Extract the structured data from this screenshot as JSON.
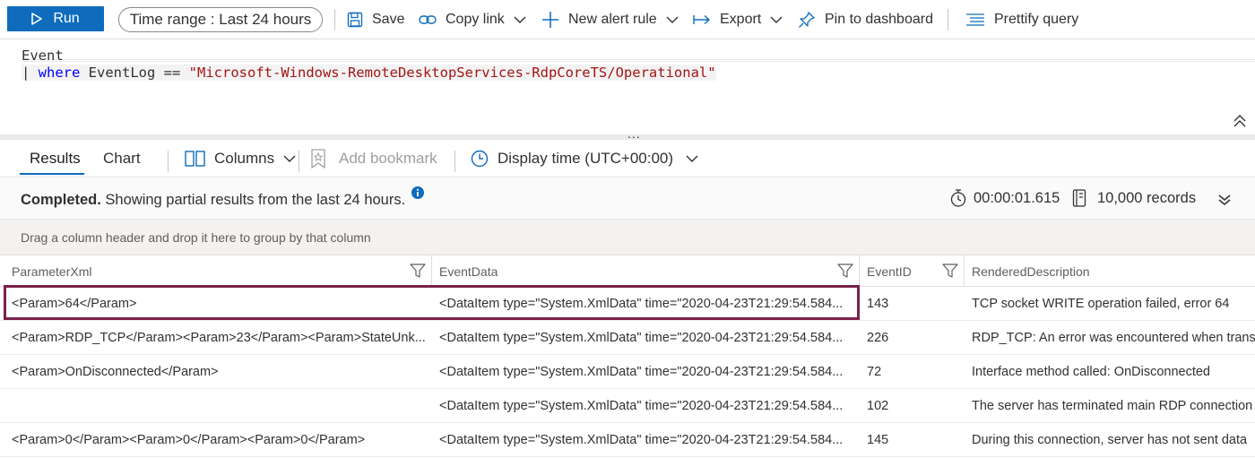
{
  "toolbar": {
    "run_label": "Run",
    "time_range_label": "Time range",
    "time_range_separator": " : ",
    "time_range_value": "Last 24 hours",
    "save_label": "Save",
    "copy_link_label": "Copy link",
    "new_alert_label": "New alert rule",
    "export_label": "Export",
    "pin_label": "Pin to dashboard",
    "prettify_label": "Prettify query",
    "accent_color": "#0f6cbd"
  },
  "editor": {
    "line1": "Event",
    "line2_pipe": "| ",
    "line2_keyword": "where",
    "line2_field": " EventLog == ",
    "line2_string": "\"Microsoft-Windows-RemoteDesktopServices-RdpCoreTS/Operational\"",
    "drag_handle": "..."
  },
  "results_tabs": {
    "results_label": "Results",
    "chart_label": "Chart",
    "columns_label": "Columns",
    "bookmark_label": "Add bookmark",
    "display_time_label": "Display time (UTC+00:00)"
  },
  "status": {
    "completed_label": "Completed.",
    "message": " Showing partial results from the last 24 hours.",
    "elapsed": "00:00:01.615",
    "records": "10,000 records"
  },
  "groupbar": {
    "hint": "Drag a column header and drop it here to group by that column"
  },
  "grid": {
    "columns": [
      "ParameterXml",
      "EventData",
      "EventID",
      "RenderedDescription"
    ],
    "rows": [
      {
        "ParameterXml": "<Param>64</Param>",
        "EventData": "<DataItem type=\"System.XmlData\" time=\"2020-04-23T21:29:54.584...",
        "EventID": "143",
        "RenderedDescription": "TCP socket WRITE operation failed, error 64"
      },
      {
        "ParameterXml": "<Param>RDP_TCP</Param><Param>23</Param><Param>StateUnk...",
        "EventData": "<DataItem type=\"System.XmlData\" time=\"2020-04-23T21:29:54.584...",
        "EventID": "226",
        "RenderedDescription": "RDP_TCP: An error was encountered when transiti"
      },
      {
        "ParameterXml": "<Param>OnDisconnected</Param>",
        "EventData": "<DataItem type=\"System.XmlData\" time=\"2020-04-23T21:29:54.584...",
        "EventID": "72",
        "RenderedDescription": "Interface method called: OnDisconnected"
      },
      {
        "ParameterXml": "",
        "EventData": "<DataItem type=\"System.XmlData\" time=\"2020-04-23T21:29:54.584...",
        "EventID": "102",
        "RenderedDescription": "The server has terminated main RDP connection"
      },
      {
        "ParameterXml": "<Param>0</Param><Param>0</Param><Param>0</Param>",
        "EventData": "<DataItem type=\"System.XmlData\" time=\"2020-04-23T21:29:54.584...",
        "EventID": "145",
        "RenderedDescription": "During this connection, server has not sent data"
      }
    ],
    "highlight_color": "#7b1f4c"
  }
}
